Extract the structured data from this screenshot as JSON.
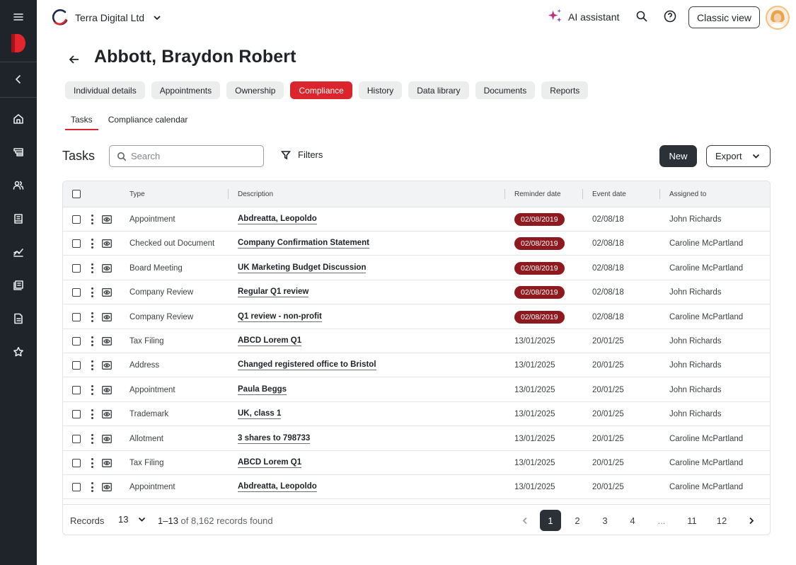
{
  "sidebar": {
    "items": [
      {
        "name": "menu-icon"
      },
      {
        "name": "collapse-icon"
      },
      {
        "name": "home-icon"
      },
      {
        "name": "entities-icon"
      },
      {
        "name": "people-icon"
      },
      {
        "name": "registers-icon"
      },
      {
        "name": "analytics-icon"
      },
      {
        "name": "library-icon"
      },
      {
        "name": "document-icon"
      },
      {
        "name": "star-icon"
      }
    ]
  },
  "topbar": {
    "org_name": "Terra Digital Ltd",
    "ai_label": "AI assistant",
    "classic_view_label": "Classic view"
  },
  "page": {
    "title": "Abbott, Braydon Robert",
    "tabs": [
      "Individual details",
      "Appointments",
      "Ownership",
      "Compliance",
      "History",
      "Data library",
      "Documents",
      "Reports"
    ],
    "active_tab": "Compliance",
    "subtabs": [
      "Tasks",
      "Compliance calendar"
    ],
    "active_subtab": "Tasks"
  },
  "toolbar": {
    "title": "Tasks",
    "search_placeholder": "Search",
    "filters_label": "Filters",
    "new_label": "New",
    "export_label": "Export"
  },
  "table": {
    "columns": [
      "Type",
      "Description",
      "Reminder date",
      "Event date",
      "Assigned to"
    ],
    "rows": [
      {
        "type": "Appointment",
        "description": "Abdreatta, Leopoldo",
        "reminder": "02/08/2019",
        "overdue": true,
        "event": "02/08/18",
        "assigned": "John Richards"
      },
      {
        "type": "Checked out Document",
        "description": "Company Confirmation Statement",
        "reminder": "02/08/2019",
        "overdue": true,
        "event": "02/08/18",
        "assigned": "Caroline McPartland"
      },
      {
        "type": "Board Meeting",
        "description": "UK Marketing Budget Discussion",
        "reminder": "02/08/2019",
        "overdue": true,
        "event": "02/08/18",
        "assigned": "Caroline McPartland"
      },
      {
        "type": "Company Review",
        "description": "Regular Q1 review",
        "reminder": "02/08/2019",
        "overdue": true,
        "event": "02/08/18",
        "assigned": "John Richards"
      },
      {
        "type": "Company Review",
        "description": "Q1 review - non-profit",
        "reminder": "02/08/2019",
        "overdue": true,
        "event": "02/08/18",
        "assigned": "Caroline McPartland"
      },
      {
        "type": "Tax Filing",
        "description": "ABCD Lorem Q1",
        "reminder": "13/01/2025",
        "overdue": false,
        "event": "20/01/25",
        "assigned": "John Richards"
      },
      {
        "type": "Address",
        "description": "Changed registered office to Bristol",
        "reminder": "13/01/2025",
        "overdue": false,
        "event": "20/01/25",
        "assigned": "John Richards"
      },
      {
        "type": "Appointment",
        "description": "Paula Beggs",
        "reminder": "13/01/2025",
        "overdue": false,
        "event": "20/01/25",
        "assigned": "John Richards"
      },
      {
        "type": "Trademark",
        "description": "UK, class 1",
        "reminder": "13/01/2025",
        "overdue": false,
        "event": "20/01/25",
        "assigned": "John Richards"
      },
      {
        "type": "Allotment",
        "description": "3 shares to 798733",
        "reminder": "13/01/2025",
        "overdue": false,
        "event": "20/01/25",
        "assigned": "Caroline McPartland"
      },
      {
        "type": "Tax Filing",
        "description": "ABCD Lorem Q1",
        "reminder": "13/01/2025",
        "overdue": false,
        "event": "20/01/25",
        "assigned": "Caroline McPartland"
      },
      {
        "type": "Appointment",
        "description": "Abdreatta, Leopoldo",
        "reminder": "13/01/2025",
        "overdue": false,
        "event": "20/01/25",
        "assigned": "Caroline McPartland"
      }
    ]
  },
  "footer": {
    "records_label": "Records",
    "page_size": "13",
    "range": "1–13",
    "range_suffix": "of 8,162 records found",
    "pages": [
      "1",
      "2",
      "3",
      "4",
      "...",
      "11",
      "12"
    ],
    "current_page": "1"
  },
  "colors": {
    "accent": "#d9252b",
    "overdue_pill": "#8e1a1f",
    "sidebar_bg": "#1e2429"
  }
}
